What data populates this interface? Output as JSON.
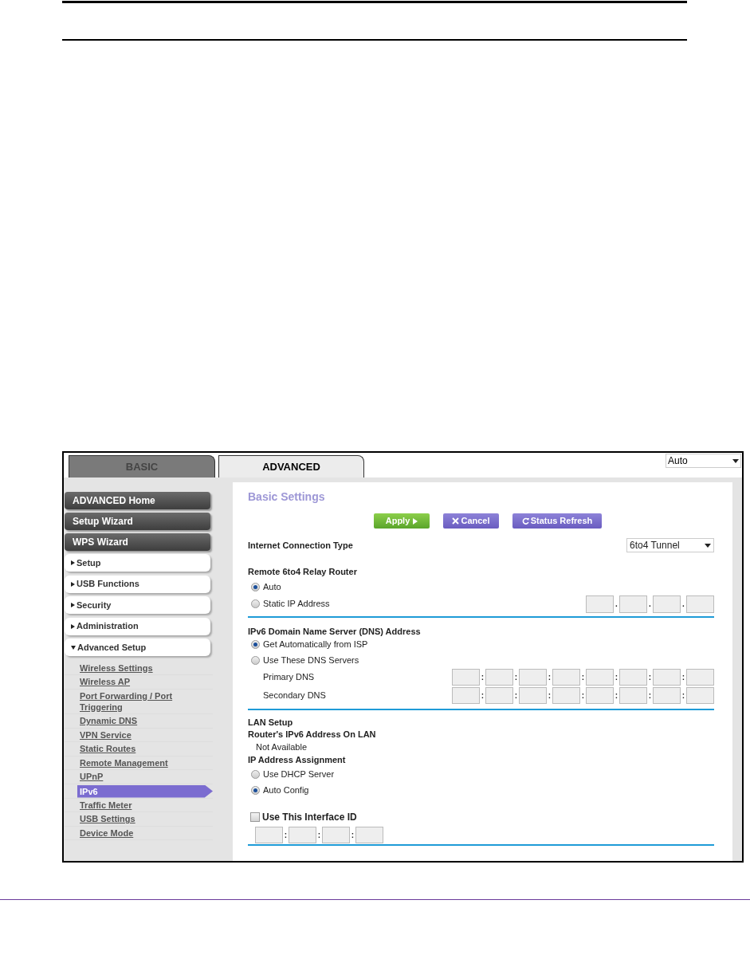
{
  "tabs": [
    {
      "label": "BASIC",
      "selected": false
    },
    {
      "label": "ADVANCED",
      "selected": true
    }
  ],
  "language_select": {
    "value": "Auto"
  },
  "sidebar": [
    {
      "label": "ADVANCED Home",
      "kind": "dark"
    },
    {
      "label": "Setup Wizard",
      "kind": "dark"
    },
    {
      "label": "WPS Wizard",
      "kind": "dark"
    },
    {
      "label": "Setup",
      "kind": "section",
      "expanded": false
    },
    {
      "label": "USB Functions",
      "kind": "section",
      "expanded": false
    },
    {
      "label": "Security",
      "kind": "section",
      "expanded": false
    },
    {
      "label": "Administration",
      "kind": "section",
      "expanded": false
    },
    {
      "label": "Advanced Setup",
      "kind": "section",
      "expanded": true,
      "children": [
        {
          "label": "Wireless Settings",
          "selected": false
        },
        {
          "label": "Wireless AP",
          "selected": false
        },
        {
          "label": "Port Forwarding / Port Triggering",
          "selected": false
        },
        {
          "label": "Dynamic DNS",
          "selected": false
        },
        {
          "label": "VPN Service",
          "selected": false
        },
        {
          "label": "Static Routes",
          "selected": false
        },
        {
          "label": "Remote Management",
          "selected": false
        },
        {
          "label": "UPnP",
          "selected": false
        },
        {
          "label": "IPv6",
          "selected": true
        },
        {
          "label": "Traffic Meter",
          "selected": false
        },
        {
          "label": "USB Settings",
          "selected": false
        },
        {
          "label": "Device Mode",
          "selected": false
        }
      ]
    }
  ],
  "panel": {
    "title": "Basic Settings",
    "buttons": [
      {
        "label": "Apply",
        "kind": "apply"
      },
      {
        "label": "Cancel",
        "kind": "cancel"
      },
      {
        "label": "Status Refresh",
        "kind": "refresh"
      }
    ],
    "connection_type": {
      "label": "Internet Connection Type",
      "value": "6to4 Tunnel"
    },
    "relay_router": {
      "heading": "Remote 6to4 Relay Router",
      "separator": ".",
      "options": [
        {
          "label": "Auto",
          "selected": true
        },
        {
          "label": "Static IP Address",
          "selected": false
        }
      ]
    },
    "dns": {
      "heading": "IPv6 Domain Name Server (DNS) Address",
      "separator": ":",
      "options": [
        {
          "label": "Get Automatically from ISP",
          "selected": true
        },
        {
          "label": "Use These DNS Servers",
          "selected": false
        }
      ],
      "servers": [
        {
          "label": "Primary DNS"
        },
        {
          "label": "Secondary DNS"
        }
      ]
    },
    "lan": {
      "heading": "LAN Setup",
      "address_label": "Router's IPv6 Address On LAN",
      "address_value": "Not Available",
      "assignment_label": "IP Address Assignment",
      "options": [
        {
          "label": "Use DHCP Server",
          "selected": false
        },
        {
          "label": "Auto Config",
          "selected": true
        }
      ],
      "interface_id": {
        "label": "Use This Interface ID",
        "checked": false,
        "separator": ":"
      }
    }
  }
}
